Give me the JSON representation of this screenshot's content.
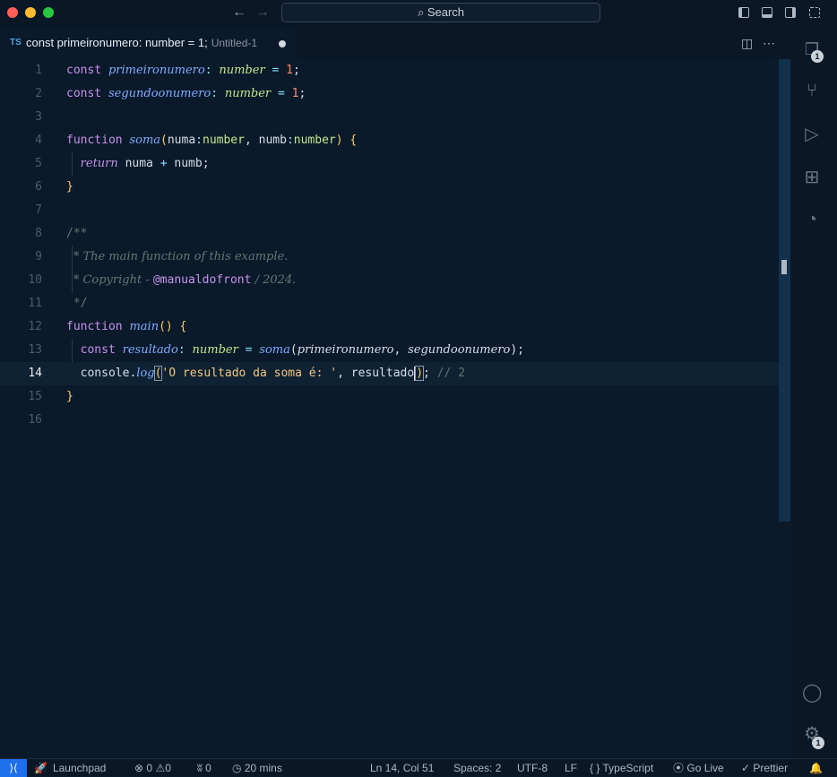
{
  "titlebar": {
    "search_label": "Search",
    "search_icon": "search-icon",
    "traffic_colors": {
      "close": "#ff5f57",
      "minimize": "#febc2e",
      "maximize": "#28c840"
    }
  },
  "tab": {
    "language_badge": "TS",
    "title": "const primeironumero: number = 1;",
    "subtitle": "Untitled-1"
  },
  "editor": {
    "current_line": 14,
    "line_numbers": [
      "1",
      "2",
      "3",
      "4",
      "5",
      "6",
      "7",
      "8",
      "9",
      "10",
      "11",
      "12",
      "13",
      "14",
      "15",
      "16"
    ],
    "tokens": {
      "const": "const",
      "primeironumero": "primeironumero",
      "segundoonumero": "segundoonumero",
      "colon": ":",
      "number": "number",
      "equals": "=",
      "one": "1",
      "semi": ";",
      "function": "function",
      "soma": "soma",
      "paren_open": "(",
      "paren_close": ")",
      "numa": "numa",
      "numb": "numb",
      "comma": ",",
      "brace_open": "{",
      "brace_close": "}",
      "return": "return",
      "plus": "+",
      "doc_open": "/**",
      "doc_line1": "* The main function of this example.",
      "doc_line2_pre": "* Copyright - ",
      "doc_tag": "@manualdofront",
      "doc_line2_post": " / 2024.",
      "doc_close": "*/",
      "main": "main",
      "resultado": "resultado",
      "console": "console",
      "dot": ".",
      "log": "log",
      "string": "'O resultado da soma é: '",
      "comment_2": "// 2"
    }
  },
  "activitybar": {
    "icons": [
      "explorer-icon",
      "source-control-icon",
      "run-debug-icon",
      "extensions-icon",
      "git-graph-icon",
      "account-icon",
      "settings-gear-icon"
    ],
    "explorer_badge": "1",
    "settings_badge": "1"
  },
  "statusbar": {
    "launchpad": "Launchpad",
    "errors": "0",
    "warnings": "0",
    "ports": "0",
    "timer": "20 mins",
    "cursor_position": "Ln 14, Col 51",
    "spaces": "Spaces: 2",
    "encoding": "UTF-8",
    "eol": "LF",
    "language_brackets": "{ }",
    "language": "TypeScript",
    "go_live": "Go Live",
    "prettier": "Prettier"
  }
}
